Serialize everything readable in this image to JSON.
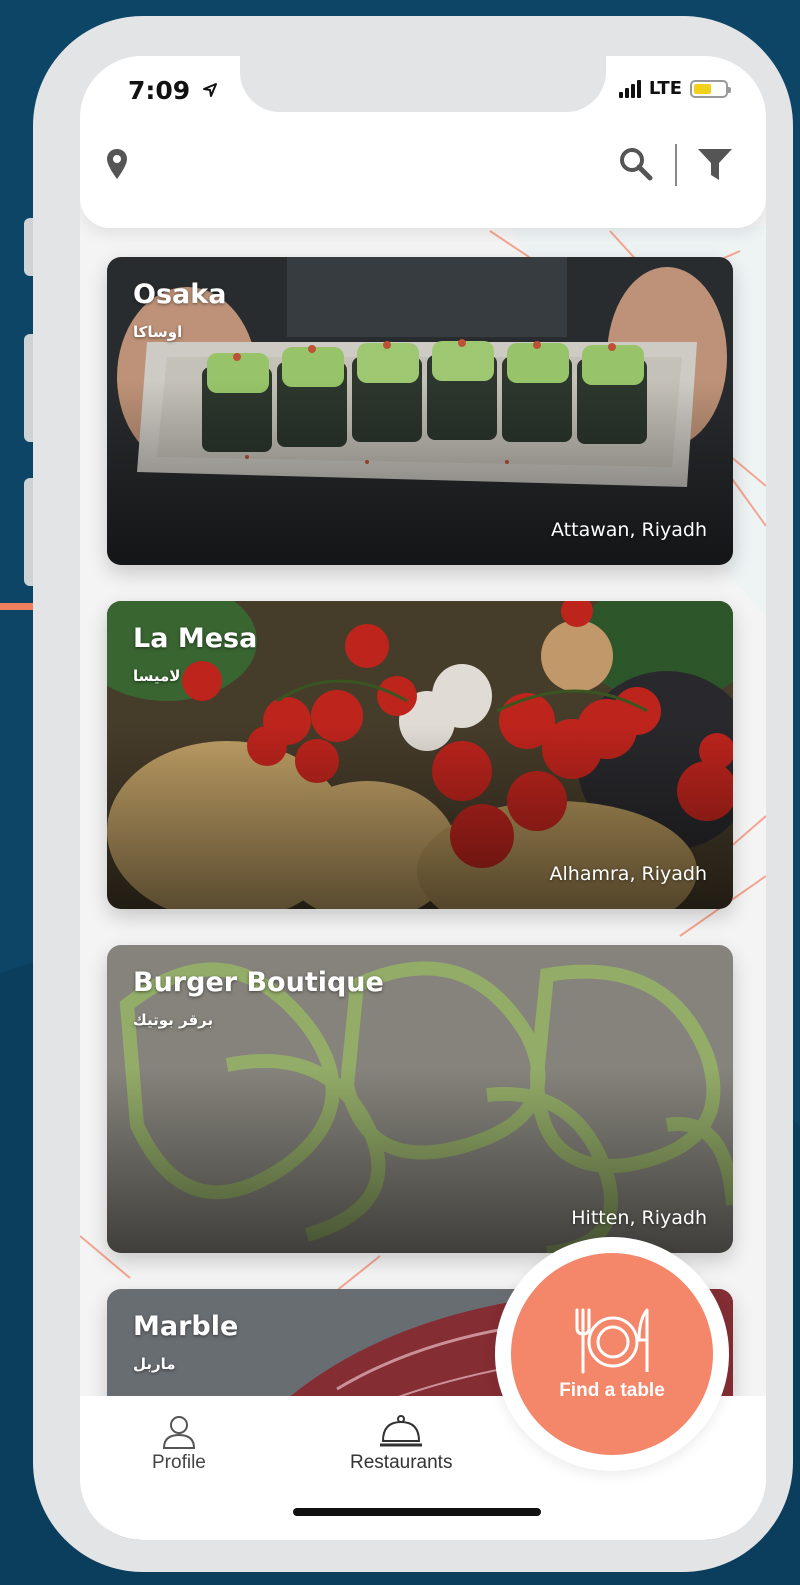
{
  "status_bar": {
    "time": "7:09",
    "network": "LTE"
  },
  "header": {
    "location_icon": "location-pin-icon",
    "search_icon": "search-icon",
    "filter_icon": "filter-icon"
  },
  "restaurants": [
    {
      "name": "Osaka",
      "name_ar": "اوساكا",
      "location": "Attawan, Riyadh"
    },
    {
      "name": "La Mesa",
      "name_ar": "لاميسا",
      "location": "Alhamra, Riyadh"
    },
    {
      "name": "Burger Boutique",
      "name_ar": "برقر بوتيك",
      "location": "Hitten, Riyadh"
    },
    {
      "name": "Marble",
      "name_ar": "ماربل",
      "location": ""
    }
  ],
  "fab": {
    "label": "Find a table",
    "icon": "fork-plate-knife-icon"
  },
  "tabbar": {
    "tabs": [
      {
        "label": "Profile",
        "icon": "person-icon"
      },
      {
        "label": "Restaurants",
        "icon": "cloche-icon"
      }
    ]
  },
  "colors": {
    "accent": "#f4876a",
    "background": "#0d4566",
    "frame": "#e3e4e6"
  }
}
